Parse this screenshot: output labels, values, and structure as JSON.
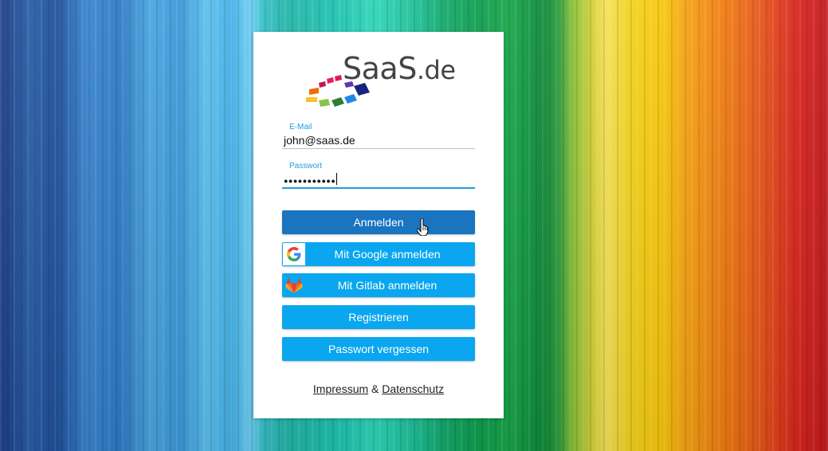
{
  "logo": {
    "brand": "SaaS",
    "tld": ".de"
  },
  "form": {
    "email_label": "E-Mail",
    "email_value": "john@saas.de",
    "password_label": "Passwort",
    "password_value": "●●●●●●●●●●●"
  },
  "buttons": {
    "login": "Anmelden",
    "google": "Mit Google anmelden",
    "gitlab": "Mit Gitlab anmelden",
    "register": "Registrieren",
    "forgot": "Passwort vergessen"
  },
  "footer": {
    "impressum": "Impressum",
    "separator": "&",
    "privacy": "Datenschutz"
  },
  "colors": {
    "primary": "#1a74bf",
    "secondary": "#0aa6f0",
    "focus": "#1e9be0"
  },
  "icons": [
    "google-icon",
    "gitlab-icon",
    "hand-pointer-icon"
  ]
}
